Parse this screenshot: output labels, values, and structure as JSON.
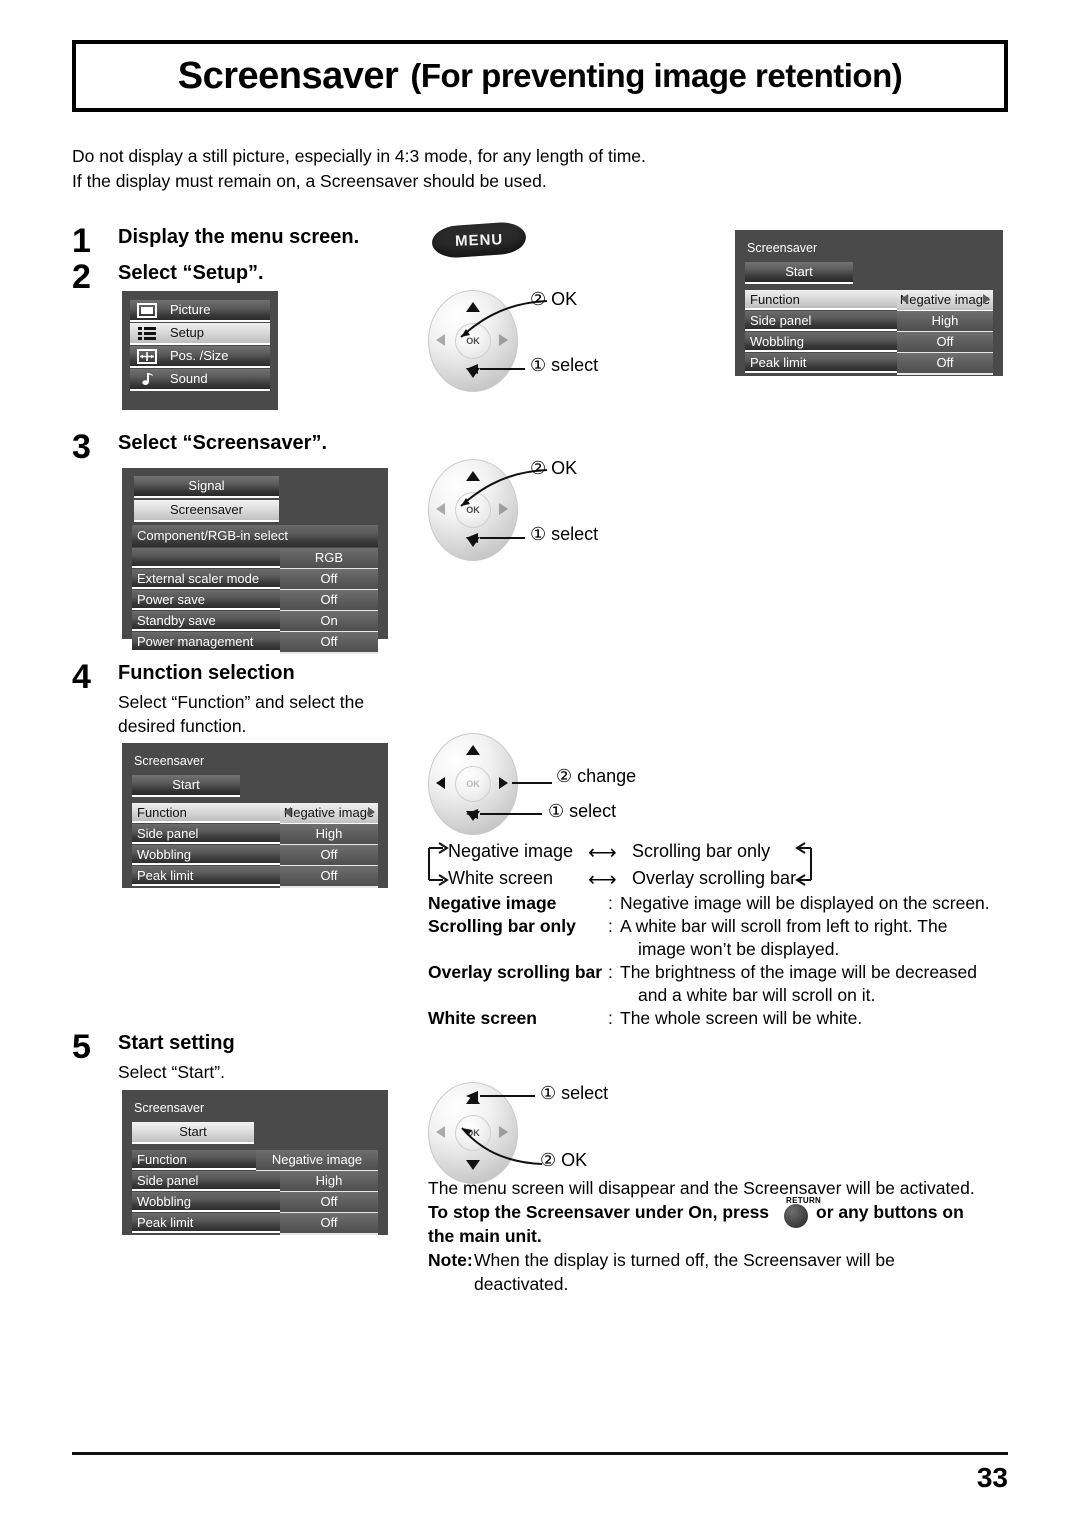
{
  "header": {
    "title_main": "Screensaver",
    "title_sub": "(For preventing image retention)"
  },
  "intro": {
    "line1": "Do not display a still picture, especially in 4:3 mode, for any length of time.",
    "line2": "If the display must remain on, a Screensaver should be used."
  },
  "steps": {
    "s1": {
      "num": "1",
      "heading": "Display the menu screen."
    },
    "s2": {
      "num": "2",
      "heading": "Select “Setup”."
    },
    "s3": {
      "num": "3",
      "heading": "Select “Screensaver”."
    },
    "s4": {
      "num": "4",
      "heading": "Function selection",
      "body_l1": "Select “Function” and select the",
      "body_l2": "desired function."
    },
    "s5": {
      "num": "5",
      "heading": "Start setting",
      "body_l1": "Select “Start”."
    }
  },
  "remote": {
    "menu_label": "MENU",
    "ok_label": "OK",
    "callout_ok": "② OK",
    "callout_select": "① select",
    "callout_change": "② change",
    "return_label": "RETURN"
  },
  "main_menu": {
    "items": [
      {
        "label": "Picture",
        "icon": "picture-icon",
        "selected": false
      },
      {
        "label": "Setup",
        "icon": "setup-list-icon",
        "selected": true
      },
      {
        "label": "Pos. /Size",
        "icon": "pos-size-icon",
        "selected": false
      },
      {
        "label": "Sound",
        "icon": "sound-note-icon",
        "selected": false
      }
    ]
  },
  "setup_menu": {
    "buttons": [
      {
        "label": "Signal",
        "selected": false
      },
      {
        "label": "Screensaver",
        "selected": true
      }
    ],
    "component_label": "Component/RGB-in select",
    "component_value": "RGB",
    "rows": [
      {
        "label": "External scaler mode",
        "value": "Off"
      },
      {
        "label": "Power save",
        "value": "Off"
      },
      {
        "label": "Standby save",
        "value": "On"
      },
      {
        "label": "Power management",
        "value": "Off"
      }
    ]
  },
  "screensaver_panel": {
    "title": "Screensaver",
    "start_label": "Start",
    "rows": [
      {
        "label": "Function",
        "value": "Negative image"
      },
      {
        "label": "Side panel",
        "value": "High"
      },
      {
        "label": "Wobbling",
        "value": "Off"
      },
      {
        "label": "Peak limit",
        "value": "Off"
      }
    ]
  },
  "cycle": {
    "a": "Negative image",
    "b": "Scrolling bar only",
    "c": "White screen",
    "d": "Overlay scrolling bar",
    "arrow_ab": "⟷",
    "arrow_cd": "⟷"
  },
  "definitions": [
    {
      "term": "Negative image",
      "colon": ":",
      "desc_l1": "Negative image will be displayed on the screen.",
      "desc_l2": ""
    },
    {
      "term": "Scrolling bar only",
      "colon": ":",
      "desc_l1": "A white bar will scroll from left to right. The",
      "desc_l2": "image won’t be displayed."
    },
    {
      "term": "Overlay scrolling bar",
      "colon": ":",
      "desc_l1": "The brightness of the image will be decreased",
      "desc_l2": "and a white bar will scroll on it."
    },
    {
      "term": "White screen",
      "colon": ":",
      "desc_l1": "The whole screen will be white.",
      "desc_l2": ""
    }
  ],
  "closing": {
    "line1": "The menu screen will disappear and the Screensaver will be activated.",
    "line2a": "To stop the Screensaver under On, press",
    "line2b": "or any buttons on",
    "line3": "the main unit.",
    "note_label": "Note:",
    "note_l1": "When the display is turned off, the Screensaver will be",
    "note_l2": "deactivated."
  },
  "footer": {
    "page_number": "33"
  },
  "colors": {
    "osd_bg": "#4a4a4a",
    "osd_row_dark": "#5a5a5a",
    "osd_row_light": "#dedede",
    "ink": "#000000"
  }
}
